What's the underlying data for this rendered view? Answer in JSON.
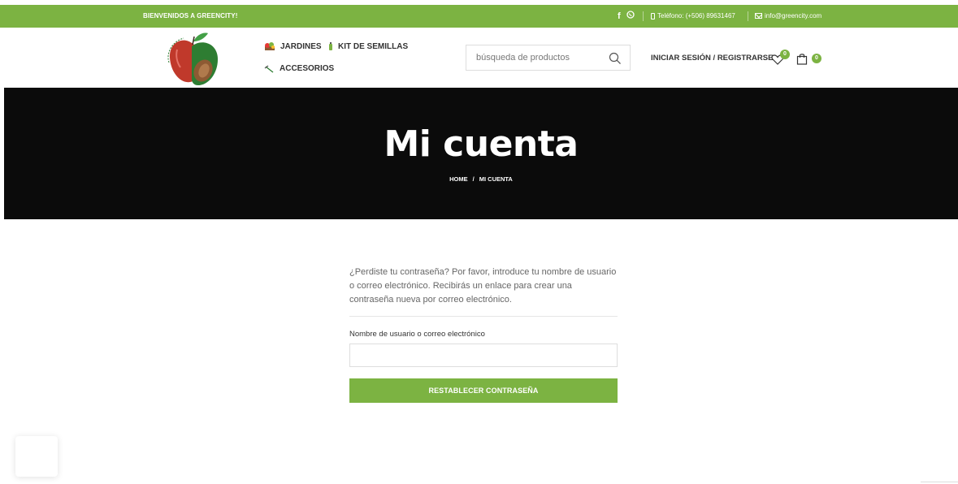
{
  "topbar": {
    "welcome": "BIENVENIDOS A GREENCITY!",
    "social_icons": [
      "facebook-icon",
      "whatsapp-icon"
    ],
    "phone": "Teléfono: (+506) 89631467",
    "email": "info@greencity.com"
  },
  "header": {
    "nav": {
      "jardines": "JARDINES",
      "kit": "KIT DE SEMILLAS",
      "accesorios": "ACCESORIOS"
    },
    "search": {
      "placeholder": "búsqueda de productos"
    },
    "login": "INICIAR SESIÓN / REGISTRARSE",
    "wishlist_count": "0",
    "cart_count": "0"
  },
  "hero": {
    "title": "Mi cuenta",
    "breadcrumb": {
      "home": "HOME",
      "separator": "/",
      "current": "MI CUENTA"
    }
  },
  "form": {
    "intro": "¿Perdiste tu contraseña? Por favor, introduce tu nombre de usuario o correo electrónico. Recibirás un enlace para crear una contraseña nueva por correo electrónico.",
    "field_label": "Nombre de usuario o correo electrónico",
    "field_value": "",
    "submit_label": "RESTABLECER CONTRASEÑA"
  },
  "colors": {
    "accent": "#7cb342",
    "hero_bg": "#0b0b0b"
  }
}
